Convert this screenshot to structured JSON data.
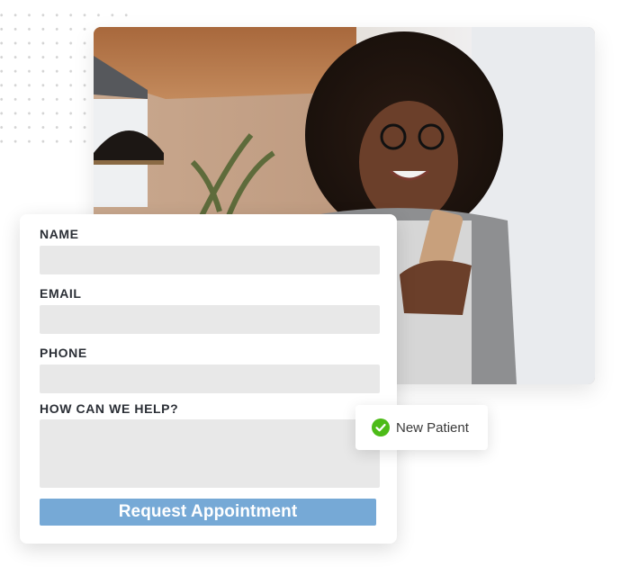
{
  "decoration": {
    "dot_grid": "dot-grid-pattern"
  },
  "hero_photo": {
    "description": "Smiling woman with glasses looking at a smartphone"
  },
  "form": {
    "fields": [
      {
        "label": "NAME",
        "value": "",
        "placeholder": ""
      },
      {
        "label": "EMAIL",
        "value": "",
        "placeholder": ""
      },
      {
        "label": "PHONE",
        "value": "",
        "placeholder": ""
      },
      {
        "label": "HOW CAN WE HELP?",
        "value": "",
        "placeholder": ""
      }
    ],
    "submit_label": "Request Appointment",
    "submit_color": "#76a9d6"
  },
  "badge": {
    "icon": "check-circle-icon",
    "label": "New Patient",
    "icon_color": "#4cbb17"
  }
}
